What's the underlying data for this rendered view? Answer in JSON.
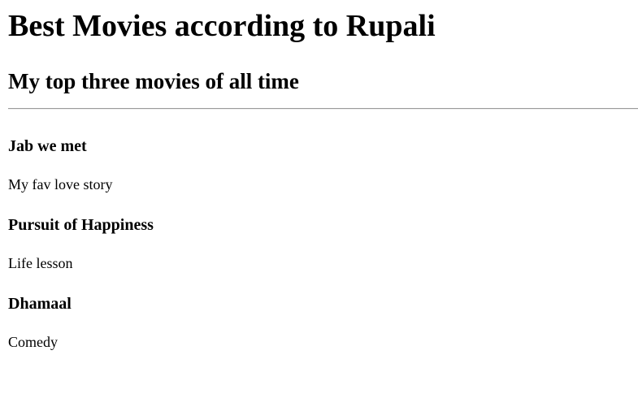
{
  "page": {
    "title": "Best Movies according to Rupali",
    "subtitle": "My top three movies of all time"
  },
  "movies": [
    {
      "name": "Jab we met",
      "description": "My fav love story"
    },
    {
      "name": "Pursuit of Happiness",
      "description": "Life lesson"
    },
    {
      "name": "Dhamaal",
      "description": "Comedy"
    }
  ]
}
